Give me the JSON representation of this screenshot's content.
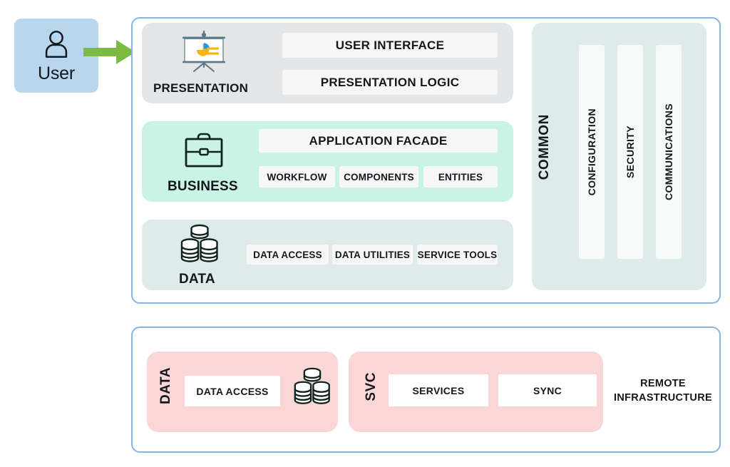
{
  "actor": {
    "label": "User",
    "icon": "person-icon",
    "box_color": "#b9d6ef",
    "arrow_icon": "right-arrow-icon",
    "arrow_color": "#7cba42"
  },
  "application_container": {
    "border_color": "#8cb4dd",
    "layers": [
      {
        "id": "presentation",
        "title": "PRESENTATION",
        "icon": "presentation-board-chart-icon",
        "color": "#e5e6e7",
        "blocks": [
          {
            "label": "USER INTERFACE"
          },
          {
            "label": "PRESENTATION LOGIC"
          }
        ]
      },
      {
        "id": "business",
        "title": "BUSINESS",
        "icon": "briefcase-icon",
        "color": "#c9f3e5",
        "blocks": [
          {
            "label": "APPLICATION FACADE"
          },
          {
            "label": "WORKFLOW"
          },
          {
            "label": "COMPONENTS"
          },
          {
            "label": "ENTITIES"
          }
        ]
      },
      {
        "id": "data",
        "title": "DATA",
        "icon": "database-stack-icon",
        "color": "#dfeaea",
        "blocks": [
          {
            "label": "DATA ACCESS"
          },
          {
            "label": "DATA UTILITIES"
          },
          {
            "label": "SERVICE TOOLS"
          }
        ]
      }
    ],
    "common": {
      "title": "COMMON",
      "color": "#dfeaea",
      "columns": [
        {
          "label": "CONFIGURATION"
        },
        {
          "label": "SECURITY"
        },
        {
          "label": "COMMUNICATIONS"
        }
      ]
    }
  },
  "remote_container": {
    "border_color": "#8cb4dd",
    "title": "REMOTE\nINFRASTRUCTURE",
    "title_line1": "REMOTE",
    "title_line2": "INFRASTRUCTURE",
    "groups": [
      {
        "id": "data",
        "label": "DATA",
        "color": "#fbd6d6",
        "icon": "database-stack-icon",
        "blocks": [
          {
            "label": "DATA ACCESS"
          }
        ]
      },
      {
        "id": "svc",
        "label": "SVC",
        "color": "#fbd6d6",
        "blocks": [
          {
            "label": "SERVICES"
          },
          {
            "label": "SYNC"
          }
        ]
      }
    ]
  }
}
